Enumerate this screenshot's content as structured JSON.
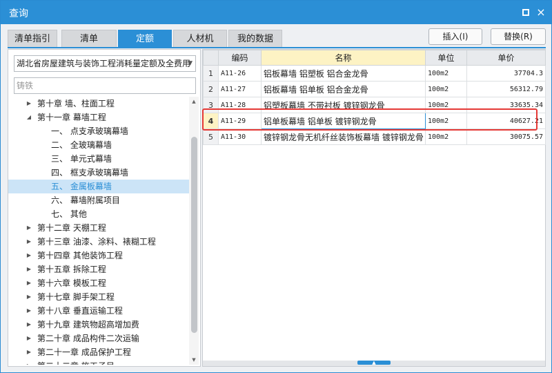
{
  "window": {
    "title": "查询",
    "maximize_label": "",
    "close_label": "×"
  },
  "tabs": [
    {
      "label": "清单指引",
      "active": false
    },
    {
      "label": "清单",
      "active": false
    },
    {
      "label": "定额",
      "active": true
    },
    {
      "label": "人材机",
      "active": false
    },
    {
      "label": "我的数据",
      "active": false
    }
  ],
  "actions": {
    "insert_label": "插入(I)",
    "replace_label": "替换(R)"
  },
  "left": {
    "library_select_value": "湖北省房屋建筑与装饰工程消耗量定额及全费用",
    "search_value": "铸铁",
    "tree": [
      {
        "label": "第十章 墙、柱面工程",
        "level": 0,
        "expander": "▶"
      },
      {
        "label": "第十一章 幕墙工程",
        "level": 0,
        "expander": "◢"
      },
      {
        "label": "一、 点支承玻璃幕墙",
        "level": 1,
        "expander": ""
      },
      {
        "label": "二、 全玻璃幕墙",
        "level": 1,
        "expander": ""
      },
      {
        "label": "三、 单元式幕墙",
        "level": 1,
        "expander": ""
      },
      {
        "label": "四、 框支承玻璃幕墙",
        "level": 1,
        "expander": ""
      },
      {
        "label": "五、 金属板幕墙",
        "level": 1,
        "expander": "",
        "selected": true
      },
      {
        "label": "六、 幕墙附属项目",
        "level": 1,
        "expander": ""
      },
      {
        "label": "七、 其他",
        "level": 1,
        "expander": ""
      },
      {
        "label": "第十二章 天棚工程",
        "level": 0,
        "expander": "▶"
      },
      {
        "label": "第十三章 油漆、涂料、裱糊工程",
        "level": 0,
        "expander": "▶"
      },
      {
        "label": "第十四章 其他装饰工程",
        "level": 0,
        "expander": "▶"
      },
      {
        "label": "第十五章 拆除工程",
        "level": 0,
        "expander": "▶"
      },
      {
        "label": "第十六章 模板工程",
        "level": 0,
        "expander": "▶"
      },
      {
        "label": "第十七章 脚手架工程",
        "level": 0,
        "expander": "▶"
      },
      {
        "label": "第十八章 垂直运输工程",
        "level": 0,
        "expander": "▶"
      },
      {
        "label": "第十九章 建筑物超高增加费",
        "level": 0,
        "expander": "▶"
      },
      {
        "label": "第二十章 成品构件二次运输",
        "level": 0,
        "expander": "▶"
      },
      {
        "label": "第二十一章 成品保护工程",
        "level": 0,
        "expander": "▶"
      },
      {
        "label": "第二十二章 施工子目",
        "level": 0,
        "expander": "▶"
      }
    ]
  },
  "table": {
    "headers": {
      "rownum": "",
      "code": "编码",
      "name": "名称",
      "unit": "单位",
      "price": "单价"
    },
    "rows": [
      {
        "n": "1",
        "code": "A11-26",
        "name": "铝板幕墙 铝塑板 铝合金龙骨",
        "unit": "100m2",
        "price": "37704.3"
      },
      {
        "n": "2",
        "code": "A11-27",
        "name": "铝板幕墙 铝单板 铝合金龙骨",
        "unit": "100m2",
        "price": "56312.79"
      },
      {
        "n": "3",
        "code": "A11-28",
        "name": "铝塑板幕墙 不带衬板 镀锌钢龙骨",
        "unit": "100m2",
        "price": "33635.34"
      },
      {
        "n": "4",
        "code": "A11-29",
        "name": "铝单板幕墙 铝单板 镀锌钢龙骨",
        "unit": "100m2",
        "price": "40627.21",
        "current": true
      },
      {
        "n": "5",
        "code": "A11-30",
        "name": "镀锌钢龙骨无机纤丝装饰板幕墙 镀锌钢龙骨",
        "unit": "100m2",
        "price": "30075.57"
      }
    ]
  },
  "colors": {
    "accent": "#2b8fd6",
    "highlight": "#e53935",
    "header_name_bg": "#fdf3c4",
    "selected_bg": "#cce4f7"
  }
}
